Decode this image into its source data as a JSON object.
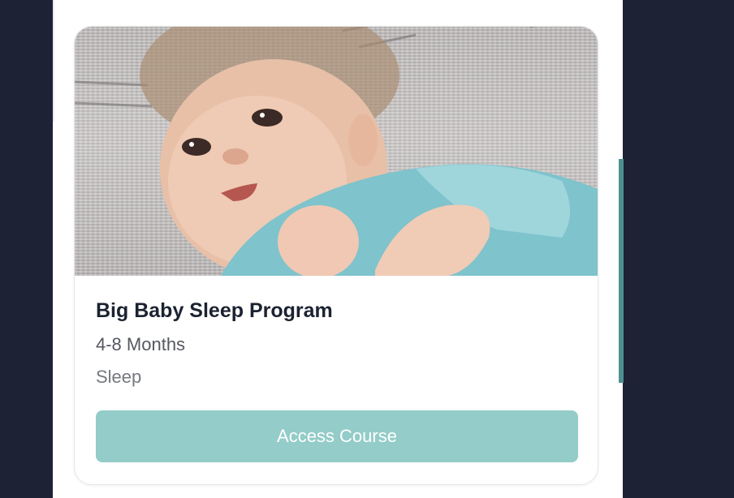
{
  "course": {
    "title": "Big Baby Sleep Program",
    "age_range": "4-8 Months",
    "category": "Sleep",
    "button_label": "Access Course",
    "image_subject": "smiling baby lying on a blanket"
  },
  "colors": {
    "page_background": "#1d2235",
    "button": "#93ccc8",
    "scroll_accent": "#4e8f90",
    "title_text": "#1b2230"
  }
}
